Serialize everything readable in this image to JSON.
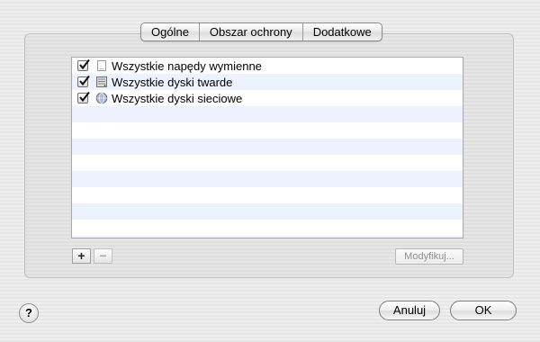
{
  "tabs": [
    {
      "label": "Ogólne"
    },
    {
      "label": "Obszar ochrony"
    },
    {
      "label": "Dodatkowe"
    }
  ],
  "list": {
    "items": [
      {
        "label": "Wszystkie napędy wymienne",
        "checked": true,
        "icon": "removable-drive-icon"
      },
      {
        "label": "Wszystkie dyski twarde",
        "checked": true,
        "icon": "hard-disk-icon"
      },
      {
        "label": "Wszystkie dyski sieciowe",
        "checked": true,
        "icon": "network-disk-icon"
      }
    ]
  },
  "controls": {
    "add_label": "+",
    "remove_label": "−",
    "modify_label": "Modyfikuj..."
  },
  "footer": {
    "help_label": "?",
    "cancel_label": "Anuluj",
    "ok_label": "OK"
  }
}
